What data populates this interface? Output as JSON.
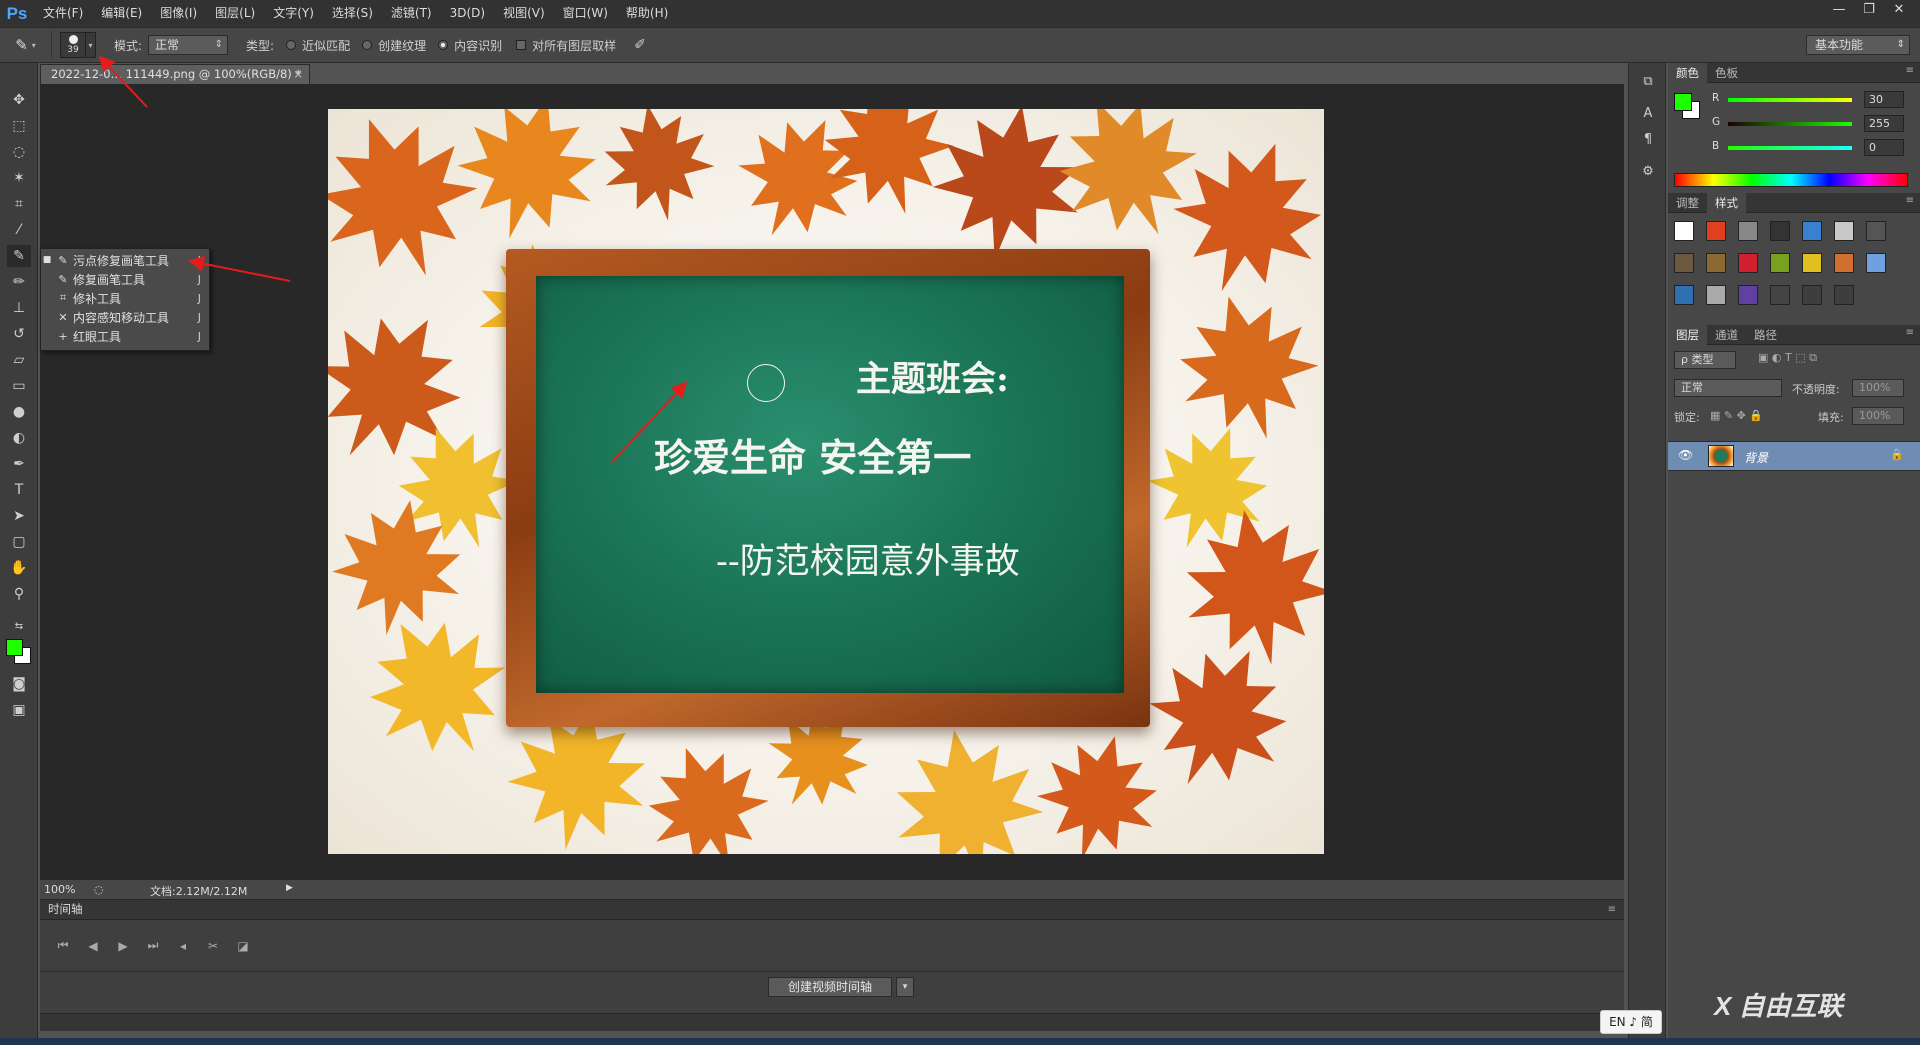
{
  "app": {
    "logo": "Ps"
  },
  "menu": [
    "文件(F)",
    "编辑(E)",
    "图像(I)",
    "图层(L)",
    "文字(Y)",
    "选择(S)",
    "滤镜(T)",
    "3D(D)",
    "视图(V)",
    "窗口(W)",
    "帮助(H)"
  ],
  "window_controls": {
    "minimize": "—",
    "restore": "❐",
    "close": "✕"
  },
  "options": {
    "brush_size": "39",
    "mode_label": "模式:",
    "mode_value": "正常",
    "type_label": "类型:",
    "radio_proximity": "近似匹配",
    "radio_texture": "创建纹理",
    "radio_content": "内容识别",
    "sample_all_layers": "对所有图层取样",
    "workspace": "基本功能"
  },
  "document": {
    "tab_title": "2022-12-0… 111449.png @ 100%(RGB/8) *",
    "tab_close": "×",
    "zoom": "100%",
    "doc_size": "文档:2.12M/2.12M"
  },
  "tool_flyout": {
    "items": [
      {
        "label": "污点修复画笔工具",
        "key": "J",
        "icon": "spot-healing-brush-icon",
        "selected": true
      },
      {
        "label": "修复画笔工具",
        "key": "J",
        "icon": "healing-brush-icon",
        "selected": false
      },
      {
        "label": "修补工具",
        "key": "J",
        "icon": "patch-icon",
        "selected": false
      },
      {
        "label": "内容感知移动工具",
        "key": "J",
        "icon": "content-aware-move-icon",
        "selected": false
      },
      {
        "label": "红眼工具",
        "key": "J",
        "icon": "red-eye-icon",
        "selected": false
      }
    ]
  },
  "image": {
    "title_line": "主题班会:",
    "main_line": "珍爱生命    安全第一",
    "sub_line": "--防范校园意外事故"
  },
  "timeline": {
    "title": "时间轴",
    "create_button": "创建视频时间轴"
  },
  "color_panel": {
    "tabs": [
      "颜色",
      "色板"
    ],
    "fg_color": "#1eff00",
    "bg_color": "#ffffff",
    "r_label": "R",
    "r_value": "30",
    "g_label": "G",
    "g_value": "255",
    "b_label": "B",
    "b_value": "0"
  },
  "styles_panel": {
    "tabs": [
      "调整",
      "样式"
    ]
  },
  "layers_panel": {
    "tabs": [
      "图层",
      "通道",
      "路径"
    ],
    "filter_kind": "ρ 类型",
    "blend_mode": "正常",
    "opacity_label": "不透明度:",
    "opacity_value": "100%",
    "lock_label": "锁定:",
    "fill_label": "填充:",
    "fill_value": "100%",
    "layer_name": "背景"
  },
  "ime": "EN ♪ 简",
  "watermark": "X 自由互联"
}
